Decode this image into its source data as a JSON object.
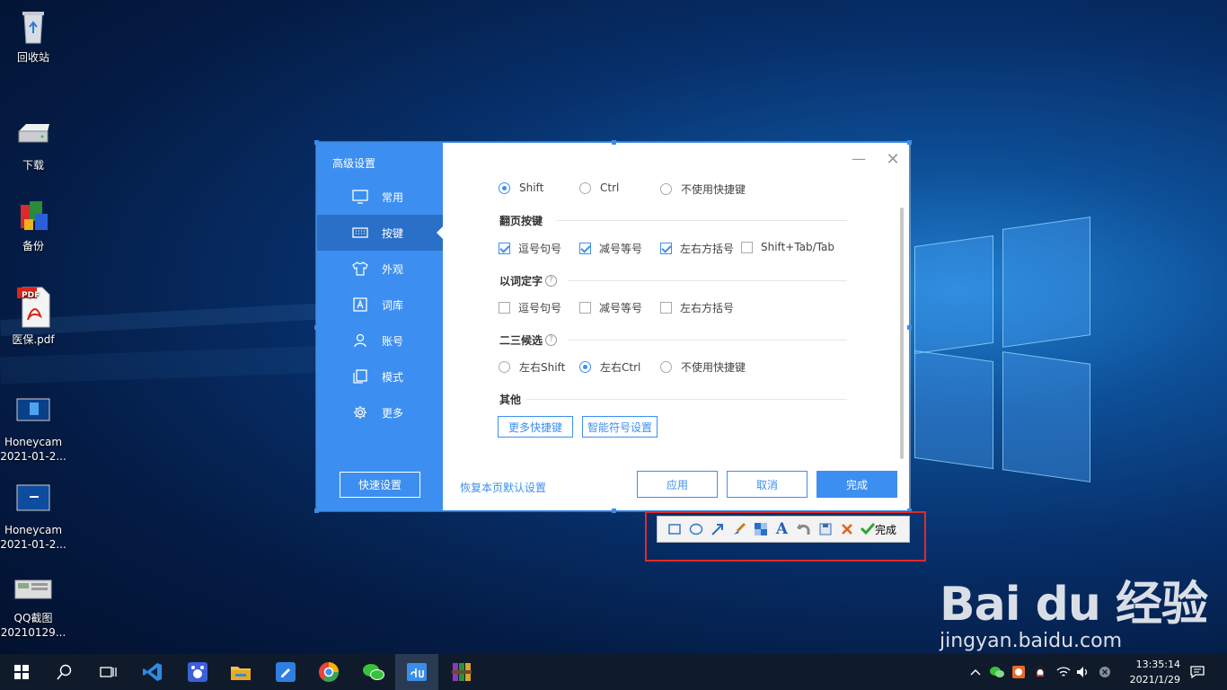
{
  "desktop": {
    "icons": [
      {
        "label": "回收站"
      },
      {
        "label": "下载"
      },
      {
        "label": "备份"
      },
      {
        "label": "医保.pdf"
      },
      {
        "label": "Honeycam\n2021-01-2..."
      },
      {
        "label": "Honeycam\n2021-01-2..."
      },
      {
        "label": "QQ截图\n20210129..."
      }
    ],
    "pdf_badge": "PDF"
  },
  "dialog": {
    "sidebar": {
      "title": "高级设置",
      "items": [
        {
          "label": "常用",
          "icon": "monitor-icon"
        },
        {
          "label": "按键",
          "icon": "keyboard-icon",
          "active": true
        },
        {
          "label": "外观",
          "icon": "shirt-icon"
        },
        {
          "label": "词库",
          "icon": "dictionary-icon"
        },
        {
          "label": "账号",
          "icon": "user-icon"
        },
        {
          "label": "模式",
          "icon": "copy-icon"
        },
        {
          "label": "更多",
          "icon": "gear-icon"
        }
      ],
      "quick_setup": "快速设置"
    },
    "shortcut_row": [
      {
        "label": "Shift",
        "selected": true
      },
      {
        "label": "Ctrl",
        "selected": false
      },
      {
        "label": "不使用快捷键",
        "selected": false
      }
    ],
    "page_turn": {
      "title": "翻页按键",
      "options": [
        {
          "label": "逗号句号",
          "checked": true
        },
        {
          "label": "减号等号",
          "checked": true
        },
        {
          "label": "左右方括号",
          "checked": true
        },
        {
          "label": "Shift+Tab/Tab",
          "checked": false
        }
      ]
    },
    "word_to_char": {
      "title": "以词定字",
      "help": "?",
      "options": [
        {
          "label": "逗号句号",
          "checked": false
        },
        {
          "label": "减号等号",
          "checked": false
        },
        {
          "label": "左右方括号",
          "checked": false
        }
      ]
    },
    "second_third": {
      "title": "二三候选",
      "help": "?",
      "options": [
        {
          "label": "左右Shift",
          "selected": false
        },
        {
          "label": "左右Ctrl",
          "selected": true
        },
        {
          "label": "不使用快捷键",
          "selected": false
        }
      ]
    },
    "other": {
      "title": "其他",
      "buttons": [
        "更多快捷键",
        "智能符号设置"
      ]
    },
    "footer": {
      "restore": "恢复本页默认设置",
      "apply": "应用",
      "cancel": "取消",
      "done": "完成"
    },
    "controls": {
      "minimize": "—",
      "close": "✕"
    }
  },
  "capture_toolbar": {
    "tools": [
      "rectangle-icon",
      "ellipse-icon",
      "arrow-icon",
      "brush-icon",
      "mosaic-icon",
      "text-icon",
      "undo-icon",
      "save-icon",
      "cancel-icon"
    ],
    "done_label": "完成"
  },
  "watermark": {
    "logo": "Bai du 经验",
    "url": "jingyan.baidu.com"
  },
  "taskbar": {
    "clock_time": "13:35:14",
    "clock_date": "2021/1/29"
  },
  "colors": {
    "accent": "#3c8ff0",
    "sidebar_active": "#2a70c9",
    "highlight_box": "#e02a2a"
  }
}
